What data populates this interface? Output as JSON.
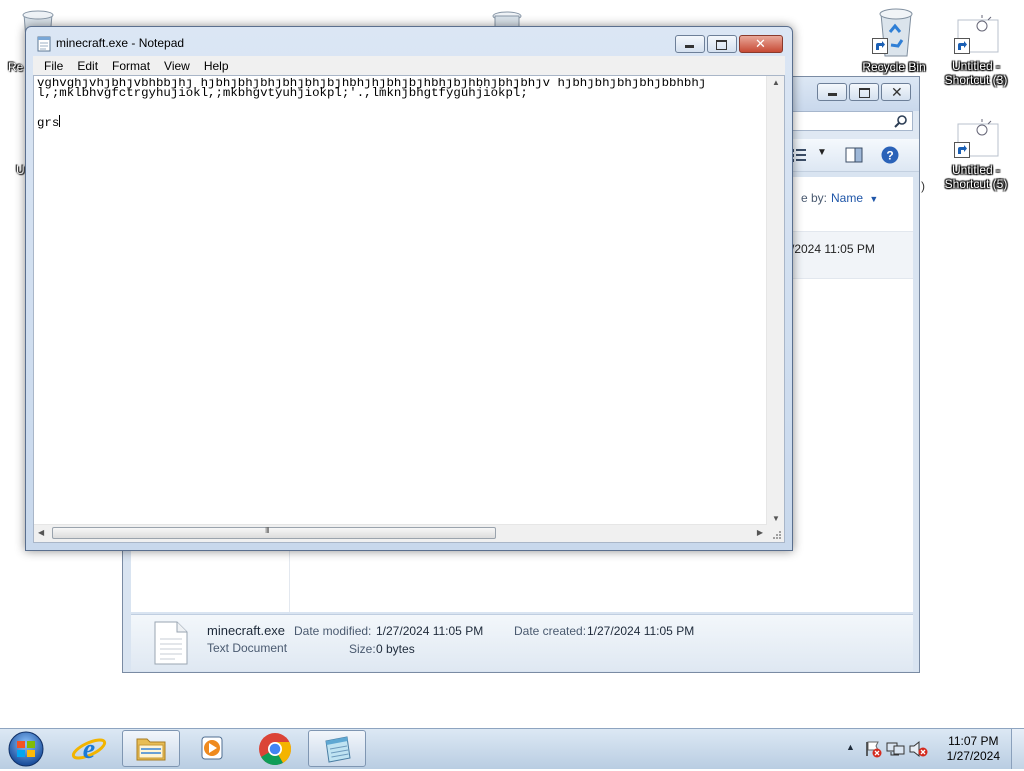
{
  "desktop": {
    "icons": [
      {
        "label": "Recycle Bin"
      },
      {
        "label": "Untitled - Shortcut (3)"
      },
      {
        "label": "Untitled - Shortcut (5)"
      }
    ],
    "partial_labels": [
      "Re",
      "U"
    ]
  },
  "explorer": {
    "sort_label": "e by:",
    "sort_value": "Name",
    "row_date": "/2024 11:05 PM",
    "partial_edge": ")",
    "details": {
      "filename": "minecraft.exe",
      "filetype": "Text Document",
      "date_modified_label": "Date modified:",
      "date_modified_value": "1/27/2024 11:05 PM",
      "date_created_label": "Date created:",
      "date_created_value": "1/27/2024 11:05 PM",
      "size_label": "Size:",
      "size_value": "0 bytes"
    }
  },
  "notepad": {
    "title": "minecraft.exe - Notepad",
    "menu": [
      "File",
      "Edit",
      "Format",
      "View",
      "Help"
    ],
    "lines": [
      "vghvghjvhjbhjvbhbbjhj hjbhjbhjbhjbhjbhjbjhbhjhjbhjbjhbhjbjhbhjbhjbhjv hjbhjbhjbhjbhjbbhbhj",
      "l,;mklbhvgfctrgyhujiokl,;mkbhgvtyuhjiokpl;'.,lmknjbhgtfyguhjiokpl;",
      "",
      "grs"
    ],
    "scroll_grip": "III"
  },
  "taskbar": {
    "time": "11:07 PM",
    "date": "1/27/2024"
  },
  "colors": {
    "taskbar": "#c9d9ea",
    "close_button": "#c74a35",
    "title_bar": "#dbe6f4"
  }
}
